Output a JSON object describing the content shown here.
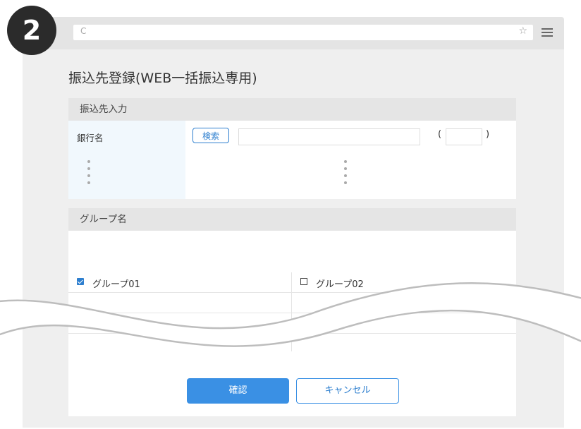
{
  "step_number": "2",
  "browser": {
    "reload_glyph": "C",
    "star_glyph": "☆",
    "icons": [
      "reload-icon",
      "star-icon",
      "menu-icon"
    ]
  },
  "page_title": "振込先登録(WEB一括振込専用)",
  "transfer_section": {
    "header": "振込先入力",
    "bank_label": "銀行名",
    "search_button": "検索",
    "bank_name_value": "",
    "open_paren": "(",
    "close_paren": ")",
    "bank_code_value": ""
  },
  "group_section": {
    "header": "グループ名",
    "groups": [
      {
        "label": "グループ01",
        "checked": true
      },
      {
        "label": "グループ02",
        "checked": false
      }
    ]
  },
  "buttons": {
    "confirm": "確認",
    "cancel": "キャンセル"
  },
  "colors": {
    "accent": "#3a90e4",
    "badge": "#2b2b2b",
    "label_cell_bg": "#f1f8fd",
    "section_header_bg": "#e5e5e5"
  }
}
